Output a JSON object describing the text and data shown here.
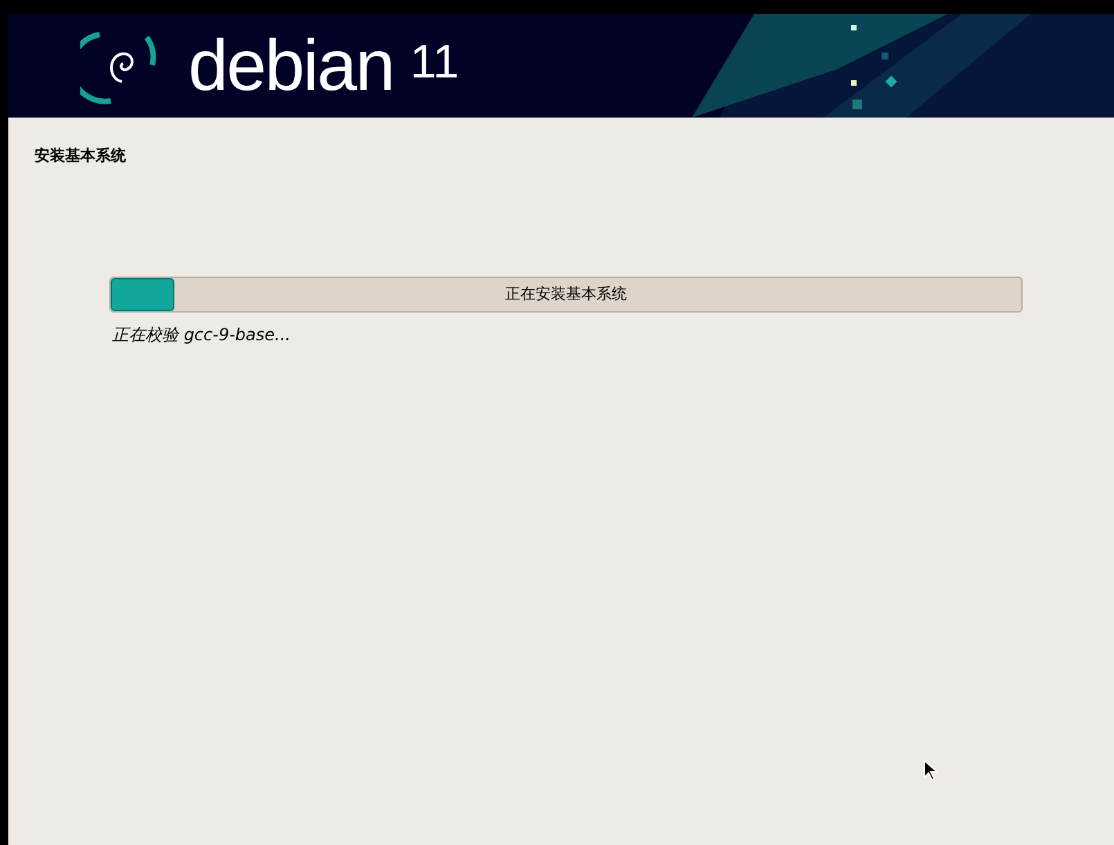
{
  "header": {
    "brand": "debian",
    "version": "11"
  },
  "page_title": "安装基本系统",
  "progress": {
    "label": "正在安装基本系统",
    "level": 0.07
  },
  "status": "正在校验 gcc-9-base..."
}
